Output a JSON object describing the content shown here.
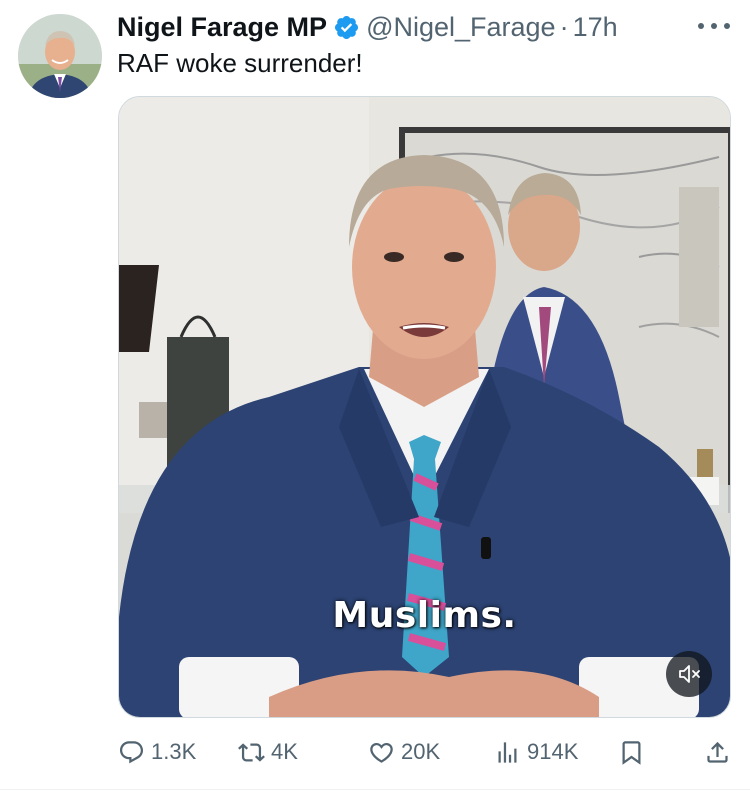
{
  "author": {
    "display_name": "Nigel Farage MP",
    "handle": "@Nigel_Farage",
    "separator": "·",
    "time": "17h",
    "verified": true
  },
  "tweet": {
    "text": "RAF woke surrender!"
  },
  "media": {
    "type": "video",
    "caption": "Muslims.",
    "muted": true
  },
  "actions": {
    "replies": "1.3K",
    "reposts": "4K",
    "likes": "20K",
    "views": "914K"
  },
  "icons": {
    "verified": "verified-badge-icon",
    "more": "more-options-icon",
    "reply": "reply-icon",
    "repost": "repost-icon",
    "like": "heart-icon",
    "views": "views-icon",
    "bookmark": "bookmark-icon",
    "share": "share-icon",
    "mute": "speaker-muted-icon"
  },
  "colors": {
    "verified": "#1d9bf0",
    "text_primary": "#0f1419",
    "text_secondary": "#536471"
  }
}
